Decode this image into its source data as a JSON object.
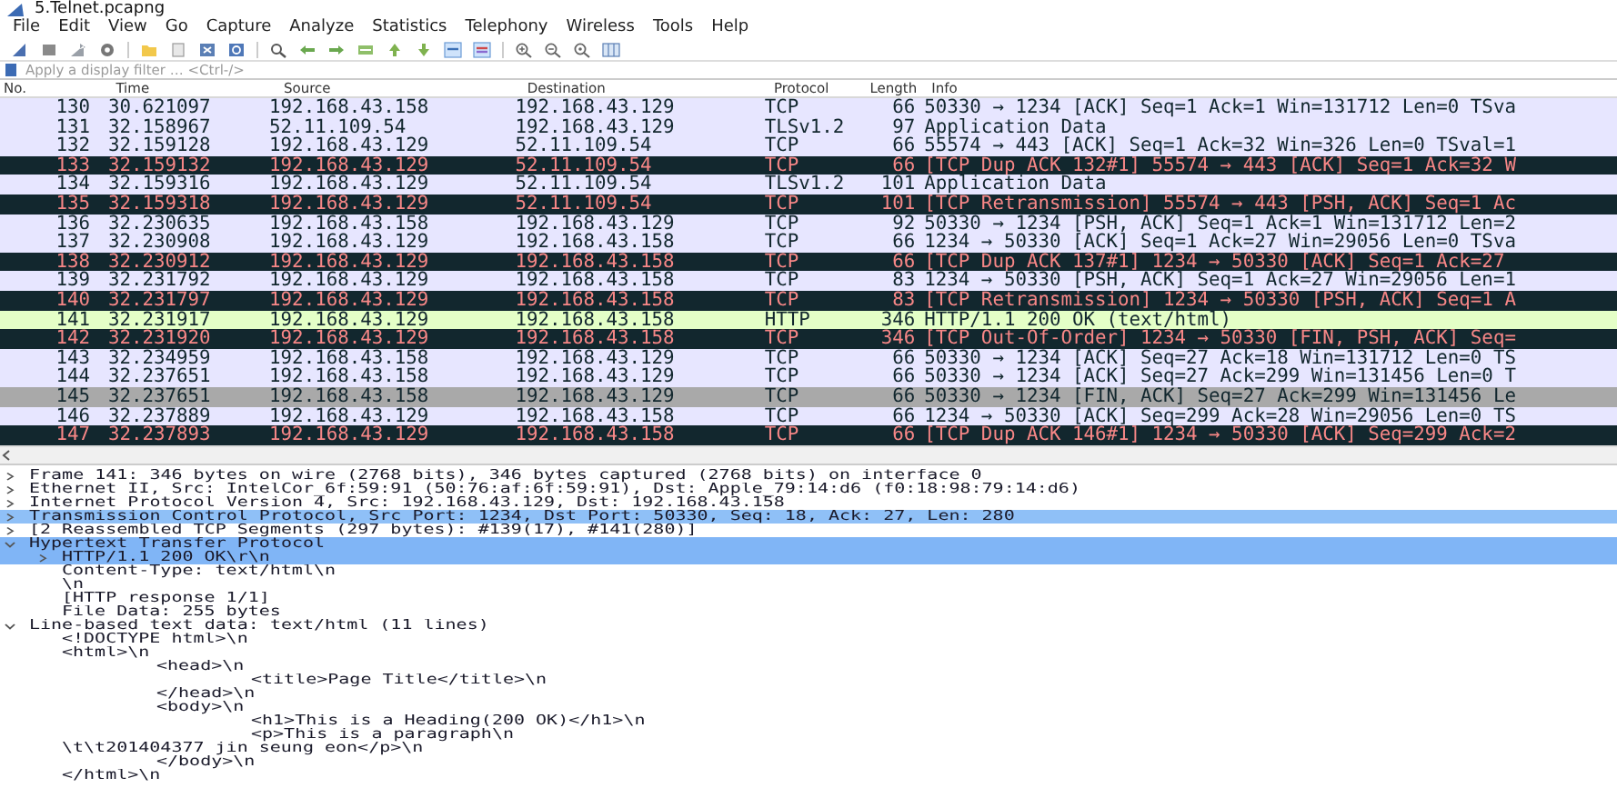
{
  "window": {
    "title": "5.Telnet.pcapng"
  },
  "menu": [
    "File",
    "Edit",
    "View",
    "Go",
    "Capture",
    "Analyze",
    "Statistics",
    "Telephony",
    "Wireless",
    "Tools",
    "Help"
  ],
  "filter": {
    "placeholder": "Apply a display filter … <Ctrl-/>"
  },
  "packet_list": {
    "columns": [
      "No.",
      "Time",
      "Source",
      "Destination",
      "Protocol",
      "Length",
      "Info"
    ],
    "rows": [
      {
        "kind": "normal",
        "selected": false,
        "cells": [
          "130",
          "30.621097",
          "192.168.43.158",
          "192.168.43.129",
          "TCP",
          "66",
          "50330 → 1234 [ACK] Seq=1 Ack=1 Win=131712 Len=0 TSva"
        ]
      },
      {
        "kind": "normal",
        "selected": false,
        "cells": [
          "131",
          "32.158967",
          "52.11.109.54",
          "192.168.43.129",
          "TLSv1.2",
          "97",
          "Application Data"
        ]
      },
      {
        "kind": "normal",
        "selected": false,
        "cells": [
          "132",
          "32.159128",
          "192.168.43.129",
          "52.11.109.54",
          "TCP",
          "66",
          "55574 → 443 [ACK] Seq=1 Ack=32 Win=326 Len=0 TSval=1"
        ]
      },
      {
        "kind": "bad",
        "selected": false,
        "cells": [
          "133",
          "32.159132",
          "192.168.43.129",
          "52.11.109.54",
          "TCP",
          "66",
          "[TCP Dup ACK 132#1] 55574 → 443 [ACK] Seq=1 Ack=32 W"
        ]
      },
      {
        "kind": "normal",
        "selected": false,
        "cells": [
          "134",
          "32.159316",
          "192.168.43.129",
          "52.11.109.54",
          "TLSv1.2",
          "101",
          "Application Data"
        ]
      },
      {
        "kind": "bad",
        "selected": false,
        "cells": [
          "135",
          "32.159318",
          "192.168.43.129",
          "52.11.109.54",
          "TCP",
          "101",
          "[TCP Retransmission] 55574 → 443 [PSH, ACK] Seq=1 Ac"
        ]
      },
      {
        "kind": "normal",
        "selected": false,
        "cells": [
          "136",
          "32.230635",
          "192.168.43.158",
          "192.168.43.129",
          "TCP",
          "92",
          "50330 → 1234 [PSH, ACK] Seq=1 Ack=1 Win=131712 Len=2"
        ]
      },
      {
        "kind": "normal",
        "selected": false,
        "cells": [
          "137",
          "32.230908",
          "192.168.43.129",
          "192.168.43.158",
          "TCP",
          "66",
          "1234 → 50330 [ACK] Seq=1 Ack=27 Win=29056 Len=0 TSva"
        ]
      },
      {
        "kind": "bad",
        "selected": false,
        "cells": [
          "138",
          "32.230912",
          "192.168.43.129",
          "192.168.43.158",
          "TCP",
          "66",
          "[TCP Dup ACK 137#1] 1234 → 50330 [ACK] Seq=1 Ack=27"
        ]
      },
      {
        "kind": "normal",
        "selected": false,
        "cells": [
          "139",
          "32.231792",
          "192.168.43.129",
          "192.168.43.158",
          "TCP",
          "83",
          "1234 → 50330 [PSH, ACK] Seq=1 Ack=27 Win=29056 Len=1"
        ]
      },
      {
        "kind": "bad",
        "selected": false,
        "cells": [
          "140",
          "32.231797",
          "192.168.43.129",
          "192.168.43.158",
          "TCP",
          "83",
          "[TCP Retransmission] 1234 → 50330 [PSH, ACK] Seq=1 A"
        ]
      },
      {
        "kind": "http",
        "selected": false,
        "cells": [
          "141",
          "32.231917",
          "192.168.43.129",
          "192.168.43.158",
          "HTTP",
          "346",
          "HTTP/1.1 200 OK  (text/html)"
        ]
      },
      {
        "kind": "bad",
        "selected": false,
        "cells": [
          "142",
          "32.231920",
          "192.168.43.129",
          "192.168.43.158",
          "TCP",
          "346",
          "[TCP Out-Of-Order] 1234 → 50330 [FIN, PSH, ACK] Seq="
        ]
      },
      {
        "kind": "normal",
        "selected": false,
        "cells": [
          "143",
          "32.234959",
          "192.168.43.158",
          "192.168.43.129",
          "TCP",
          "66",
          "50330 → 1234 [ACK] Seq=27 Ack=18 Win=131712 Len=0 TS"
        ]
      },
      {
        "kind": "normal",
        "selected": false,
        "cells": [
          "144",
          "32.237651",
          "192.168.43.158",
          "192.168.43.129",
          "TCP",
          "66",
          "50330 → 1234 [ACK] Seq=27 Ack=299 Win=131456 Len=0 T"
        ]
      },
      {
        "kind": "normal",
        "selected": true,
        "cells": [
          "145",
          "32.237651",
          "192.168.43.158",
          "192.168.43.129",
          "TCP",
          "66",
          "50330 → 1234 [FIN, ACK] Seq=27 Ack=299 Win=131456 Le"
        ]
      },
      {
        "kind": "normal",
        "selected": false,
        "cells": [
          "146",
          "32.237889",
          "192.168.43.129",
          "192.168.43.158",
          "TCP",
          "66",
          "1234 → 50330 [ACK] Seq=299 Ack=28 Win=29056 Len=0 TS"
        ]
      },
      {
        "kind": "bad",
        "selected": false,
        "cells": [
          "147",
          "32.237893",
          "192.168.43.129",
          "192.168.43.158",
          "TCP",
          "66",
          "[TCP Dup ACK 146#1] 1234 → 50330 [ACK] Seq=299 Ack=2"
        ]
      }
    ]
  },
  "details": [
    {
      "text": "Frame 141: 346 bytes on wire (2768 bits), 346 bytes captured (2768 bits) on interface 0",
      "expanded": false,
      "selected": false
    },
    {
      "text": "Ethernet II, Src: IntelCor_6f:59:91 (50:76:af:6f:59:91), Dst: Apple_79:14:d6 (f0:18:98:79:14:d6)",
      "expanded": false,
      "selected": false
    },
    {
      "text": "Internet Protocol Version 4, Src: 192.168.43.129, Dst: 192.168.43.158",
      "expanded": false,
      "selected": false
    },
    {
      "text": "Transmission Control Protocol, Src Port: 1234, Dst Port: 50330, Seq: 18, Ack: 27, Len: 280",
      "expanded": false,
      "selected": true
    },
    {
      "text": "[2 Reassembled TCP Segments (297 bytes): #139(17), #141(280)]",
      "expanded": false,
      "selected": false
    },
    {
      "text": "Hypertext Transfer Protocol",
      "expanded": true,
      "selected": true,
      "children": [
        {
          "text": "HTTP/1.1 200 OK\\r\\n",
          "expanded": false,
          "selected": true
        },
        {
          "text": "Content-Type: text/html\\n",
          "selected": false
        },
        {
          "text": "\\n",
          "selected": false
        },
        {
          "text": "[HTTP response 1/1]",
          "selected": false
        },
        {
          "text": "File Data: 255 bytes",
          "selected": false
        }
      ]
    },
    {
      "text": "Line-based text data: text/html (11 lines)",
      "expanded": true,
      "selected": false,
      "children": [
        {
          "text": "<!DOCTYPE html>\\n",
          "selected": false
        },
        {
          "text": "<html>\\n",
          "selected": false
        },
        {
          "text": "\t<head>\\n",
          "selected": false
        },
        {
          "text": "\t\t<title>Page Title</title>\\n",
          "selected": false
        },
        {
          "text": "\t</head>\\n",
          "selected": false
        },
        {
          "text": "\t<body>\\n",
          "selected": false
        },
        {
          "text": "\t\t<h1>This is a Heading(200 OK)</h1>\\n",
          "selected": false
        },
        {
          "text": "\t\t<p>This is a paragraph\\n",
          "selected": false
        },
        {
          "text": "\\t\\t201404377 jin seung eon</p>\\n",
          "selected": false
        },
        {
          "text": "\t</body>\\n",
          "selected": false
        },
        {
          "text": "</html>\\n",
          "selected": false
        }
      ]
    }
  ]
}
